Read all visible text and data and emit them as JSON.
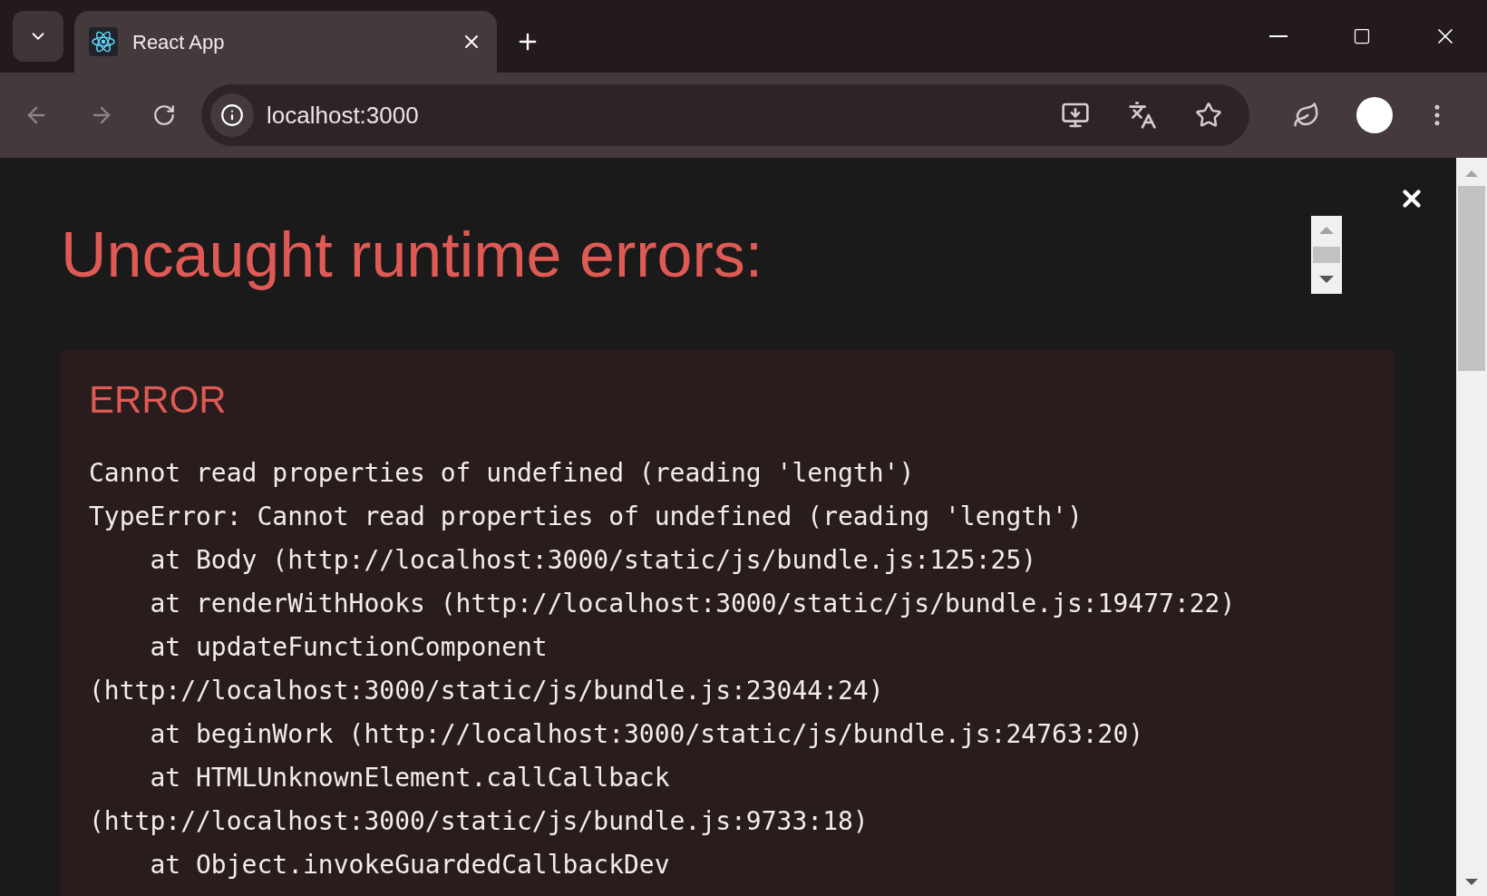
{
  "browser": {
    "tab": {
      "title": "React App",
      "selected": true
    },
    "address": "localhost:3000"
  },
  "overlay": {
    "title": "Uncaught runtime errors:",
    "error": {
      "label": "ERROR",
      "lines": [
        "Cannot read properties of undefined (reading 'length')",
        "TypeError: Cannot read properties of undefined (reading 'length')",
        "    at Body (http://localhost:3000/static/js/bundle.js:125:25)",
        "    at renderWithHooks (http://localhost:3000/static/js/bundle.js:19477:22)",
        "    at updateFunctionComponent",
        "(http://localhost:3000/static/js/bundle.js:23044:24)",
        "    at beginWork (http://localhost:3000/static/js/bundle.js:24763:20)",
        "    at HTMLUnknownElement.callCallback",
        "(http://localhost:3000/static/js/bundle.js:9733:18)",
        "    at Object.invokeGuardedCallbackDev"
      ]
    }
  }
}
